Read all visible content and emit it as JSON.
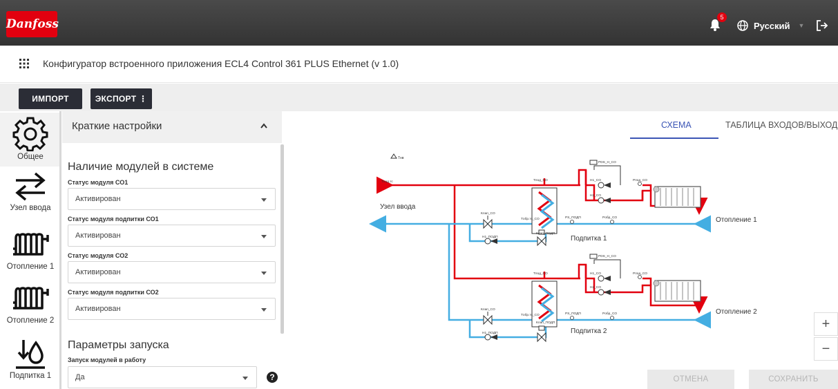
{
  "header": {
    "logo_text": "Danfoss",
    "notification_count": "5",
    "language": "Русский",
    "icons": [
      "bell-icon",
      "globe-icon",
      "logout-icon"
    ]
  },
  "app": {
    "title": "Конфигуратор встроенного приложения ECL4 Control 361 PLUS Ethernet (v 1.0)"
  },
  "toolbar": {
    "import_label": "ИМПОРТ",
    "export_label": "ЭКСПОРТ ⋮"
  },
  "sidebar": {
    "items": [
      {
        "label": "Общее",
        "icon": "gear-icon",
        "active": true
      },
      {
        "label": "Узел ввода",
        "icon": "arrows-icon",
        "active": false
      },
      {
        "label": "Отопление 1",
        "icon": "radiator-icon",
        "active": false
      },
      {
        "label": "Отопление 2",
        "icon": "radiator-icon",
        "active": false
      },
      {
        "label": "Подпитка 1",
        "icon": "water-drop-icon",
        "active": false
      }
    ]
  },
  "panel": {
    "title": "Краткие настройки",
    "modules_heading": "Наличие модулей в системе",
    "fields": [
      {
        "label": "Статус модуля СО1",
        "value": "Активирован"
      },
      {
        "label": "Статус модуля подпитки СО1",
        "value": "Активирован"
      },
      {
        "label": "Статус модуля СО2",
        "value": "Активирован"
      },
      {
        "label": "Статус модуля подпитки СО2",
        "value": "Активирован"
      }
    ],
    "launch_heading": "Параметры запуска",
    "launch_field": {
      "label": "Запуск модулей в работу",
      "value": "Да"
    }
  },
  "tabs": {
    "schema": "СХЕМА",
    "table": "ТАБЛИЦА ВХОДОВ/ВЫХОДОВ"
  },
  "diagram": {
    "node_label": "Узел ввода",
    "heating1": "Отопление 1",
    "heating2": "Отопление 2",
    "feed1": "Подпитка 1",
    "feed2": "Подпитка 2",
    "small": {
      "t_nv": "Tнв",
      "t_pod": "Tпод.тс",
      "t_pod_co": "Tпод_CO",
      "t_obr": "Tобр.тс_CO",
      "n1": "Н1_CO",
      "n2": "Н2_CO",
      "pds": "PDS_Н_CO",
      "p_pod": "Pпод_CO",
      "p_obr": "Pобр_CO",
      "p_podp": "PS_ПОДП",
      "k_co": "Клап_CO",
      "k_podp": "Клап_ПОДП",
      "n_podp": "Н1_ПОДП"
    },
    "colors": {
      "supply": "#e2000f",
      "return": "#44aee2",
      "grey": "#555555"
    }
  },
  "zoom": {
    "in": "+",
    "out": "−"
  },
  "actions": {
    "cancel": "ОТМЕНА",
    "save": "СОХРАНИТЬ"
  }
}
